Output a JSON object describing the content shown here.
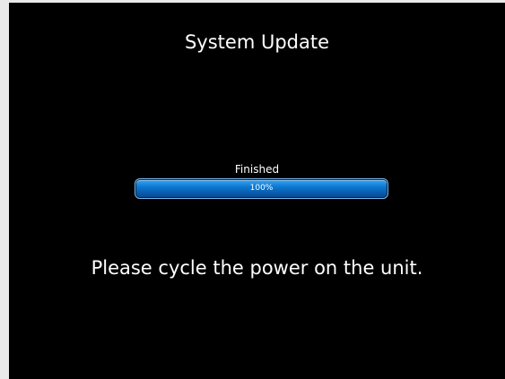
{
  "screen": {
    "title": "System Update",
    "status": "Finished",
    "message": "Please cycle the power on the unit."
  },
  "progress": {
    "percent": 100,
    "label": "100%"
  },
  "colors": {
    "background": "#000000",
    "text": "#ffffff",
    "progress_fill": "#0f7dd6",
    "progress_border": "#7ab9ef"
  }
}
